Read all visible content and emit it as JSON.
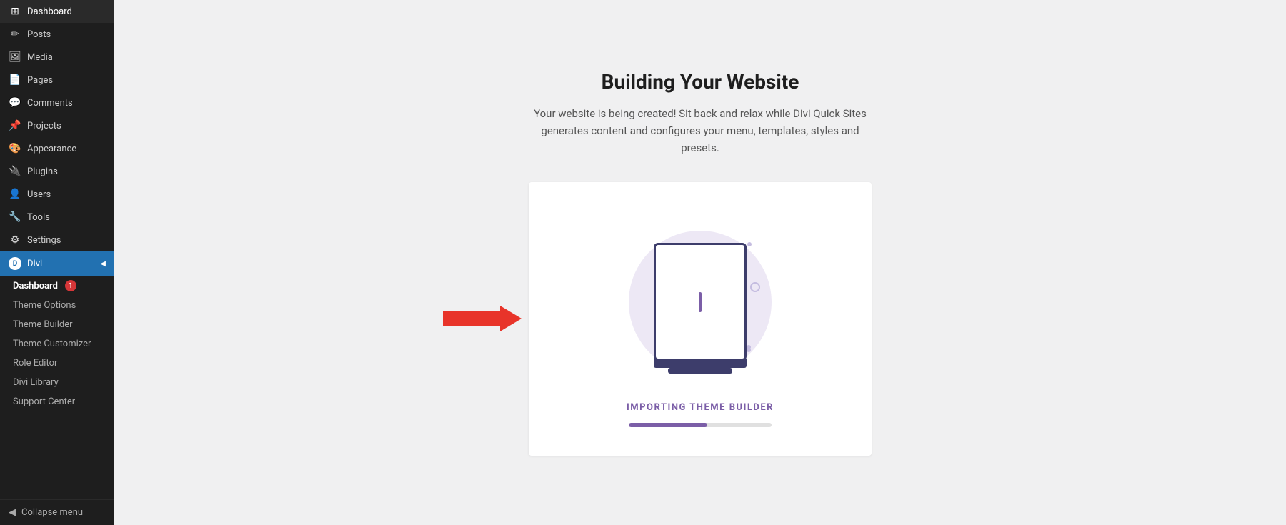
{
  "sidebar": {
    "items": [
      {
        "id": "dashboard",
        "label": "Dashboard",
        "icon": "⊞"
      },
      {
        "id": "posts",
        "label": "Posts",
        "icon": "✏"
      },
      {
        "id": "media",
        "label": "Media",
        "icon": "🖼"
      },
      {
        "id": "pages",
        "label": "Pages",
        "icon": "📄"
      },
      {
        "id": "comments",
        "label": "Comments",
        "icon": "💬"
      },
      {
        "id": "projects",
        "label": "Projects",
        "icon": "📌"
      },
      {
        "id": "appearance",
        "label": "Appearance",
        "icon": "🎨"
      },
      {
        "id": "plugins",
        "label": "Plugins",
        "icon": "🔌"
      },
      {
        "id": "users",
        "label": "Users",
        "icon": "👤"
      },
      {
        "id": "tools",
        "label": "Tools",
        "icon": "🔧"
      },
      {
        "id": "settings",
        "label": "Settings",
        "icon": "⚙"
      }
    ],
    "divi": {
      "label": "Divi",
      "submenu": [
        {
          "id": "dashboard-sub",
          "label": "Dashboard",
          "badge": "1"
        },
        {
          "id": "theme-options",
          "label": "Theme Options"
        },
        {
          "id": "theme-builder",
          "label": "Theme Builder"
        },
        {
          "id": "theme-customizer",
          "label": "Theme Customizer"
        },
        {
          "id": "role-editor",
          "label": "Role Editor"
        },
        {
          "id": "divi-library",
          "label": "Divi Library"
        },
        {
          "id": "support-center",
          "label": "Support Center"
        }
      ]
    },
    "collapse_label": "Collapse menu"
  },
  "main": {
    "title": "Building Your Website",
    "subtitle": "Your website is being created! Sit back and relax while Divi Quick Sites generates content and configures your menu, templates, styles and presets.",
    "card": {
      "progress_label": "IMPORTING THEME BUILDER",
      "progress_percent": 55
    }
  }
}
